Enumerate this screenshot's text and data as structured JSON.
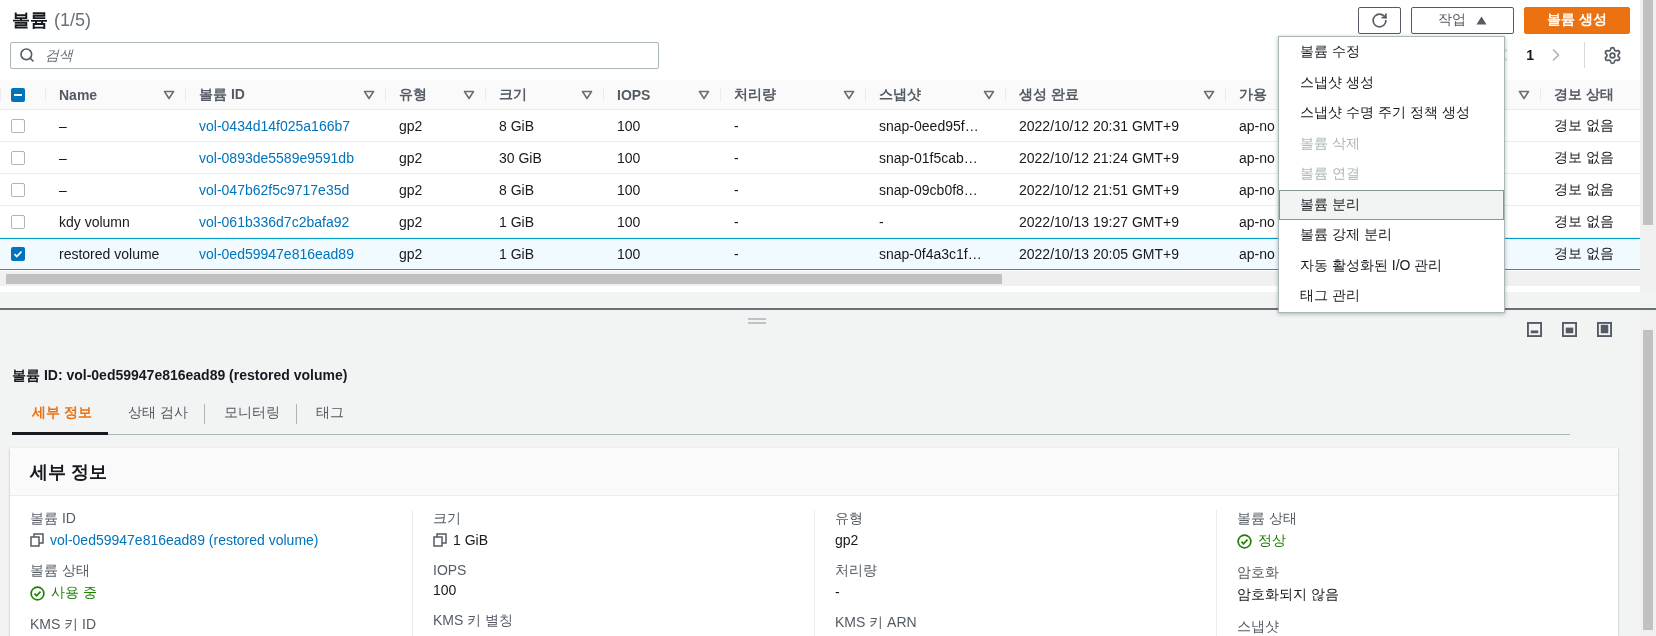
{
  "header": {
    "title": "볼륨",
    "count": "(1/5)"
  },
  "toolbar": {
    "actions_label": "작업",
    "create_label": "볼륨 생성"
  },
  "search": {
    "placeholder": "검색"
  },
  "pagination": {
    "page": "1"
  },
  "table": {
    "select_all": {
      "indeterminate": true
    },
    "columns": [
      {
        "label": "Name",
        "filter": true,
        "kind": "text"
      },
      {
        "label": "볼륨 ID",
        "filter": true,
        "kind": "link"
      },
      {
        "label": "유형",
        "filter": true,
        "kind": "text"
      },
      {
        "label": "크기",
        "filter": true,
        "kind": "text"
      },
      {
        "label": "IOPS",
        "filter": true,
        "kind": "text"
      },
      {
        "label": "처리량",
        "filter": true,
        "kind": "text"
      },
      {
        "label": "스냅샷",
        "filter": true,
        "kind": "text"
      },
      {
        "label": "생성 완료",
        "filter": true,
        "kind": "text"
      },
      {
        "label": "가용",
        "filter": true,
        "kind": "text"
      },
      {
        "label": "경보 상태",
        "filter": false,
        "kind": "text"
      }
    ],
    "rows": [
      {
        "selected": false,
        "cells": [
          "–",
          "vol-0434d14f025a166b7",
          "gp2",
          "8 GiB",
          "100",
          "-",
          "snap-0eed95f…",
          "2022/10/12 20:31 GMT+9",
          "ap-no",
          "경보 없음"
        ]
      },
      {
        "selected": false,
        "cells": [
          "–",
          "vol-0893de5589e9591db",
          "gp2",
          "30 GiB",
          "100",
          "-",
          "snap-01f5cab…",
          "2022/10/12 21:24 GMT+9",
          "ap-no",
          "경보 없음"
        ]
      },
      {
        "selected": false,
        "cells": [
          "–",
          "vol-047b62f5c9717e35d",
          "gp2",
          "8 GiB",
          "100",
          "-",
          "snap-09cb0f8…",
          "2022/10/12 21:51 GMT+9",
          "ap-no",
          "경보 없음"
        ]
      },
      {
        "selected": false,
        "cells": [
          "kdy volumn",
          "vol-061b336d7c2bafa92",
          "gp2",
          "1 GiB",
          "100",
          "-",
          "-",
          "2022/10/13 19:27 GMT+9",
          "ap-no",
          "경보 없음"
        ]
      },
      {
        "selected": true,
        "cells": [
          "restored volume",
          "vol-0ed59947e816ead89",
          "gp2",
          "1 GiB",
          "100",
          "-",
          "snap-0f4a3c1f…",
          "2022/10/13 20:05 GMT+9",
          "ap-no",
          "경보 없음"
        ]
      }
    ]
  },
  "actions_menu": {
    "items": [
      {
        "label": "볼륨 수정",
        "disabled": false,
        "highlighted": false
      },
      {
        "label": "스냅샷 생성",
        "disabled": false,
        "highlighted": false
      },
      {
        "label": "스냅샷 수명 주기 정책 생성",
        "disabled": false,
        "highlighted": false
      },
      {
        "label": "볼륨 삭제",
        "disabled": true,
        "highlighted": false
      },
      {
        "label": "볼륨 연결",
        "disabled": true,
        "highlighted": false
      },
      {
        "label": "볼륨 분리",
        "disabled": false,
        "highlighted": true
      },
      {
        "label": "볼륨 강제 분리",
        "disabled": false,
        "highlighted": false
      },
      {
        "label": "자동 활성화된 I/O 관리",
        "disabled": false,
        "highlighted": false
      },
      {
        "label": "태그 관리",
        "disabled": false,
        "highlighted": false
      }
    ]
  },
  "details": {
    "title": "볼륨 ID: vol-0ed59947e816ead89 (restored volume)",
    "tabs": [
      {
        "label": "세부 정보",
        "selected": true
      },
      {
        "label": "상태 검사",
        "selected": false
      },
      {
        "label": "모니터링",
        "selected": false
      },
      {
        "label": "태그",
        "selected": false
      }
    ],
    "card_title": "세부 정보",
    "columns": [
      [
        {
          "label": "볼륨 ID",
          "kind": "copy-link",
          "value": "vol-0ed59947e816ead89 (restored volume)"
        },
        {
          "label": "볼륨 상태",
          "kind": "status",
          "value": "사용 중"
        },
        {
          "label": "KMS 키 ID"
        }
      ],
      [
        {
          "label": "크기",
          "kind": "copy",
          "value": "1 GiB"
        },
        {
          "label": "IOPS",
          "kind": "text",
          "value": "100"
        },
        {
          "label": "KMS 키 별칭"
        }
      ],
      [
        {
          "label": "유형",
          "kind": "text",
          "value": "gp2"
        },
        {
          "label": "처리량",
          "kind": "text",
          "value": "-"
        },
        {
          "label": "KMS 키 ARN"
        }
      ],
      [
        {
          "label": "볼륨 상태",
          "kind": "status",
          "value": "정상"
        },
        {
          "label": "암호화",
          "kind": "text",
          "value": "암호화되지 않음"
        },
        {
          "label": "스냅샷"
        }
      ]
    ]
  }
}
